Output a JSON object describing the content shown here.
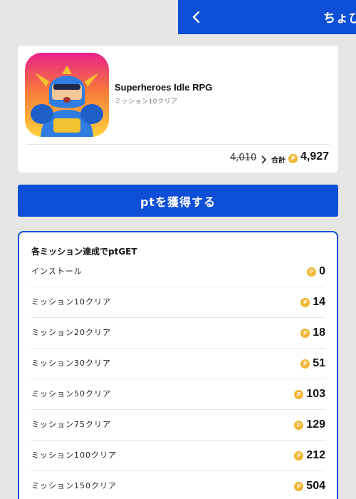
{
  "header": {
    "title": "ちょびリッチ",
    "back_icon": "chevron-left-icon",
    "color": "#0d4fd6"
  },
  "app": {
    "name": "Superheroes Idle RPG",
    "subtitle": "ミッション10クリア",
    "old_points": "4,010",
    "total_label": "合計",
    "total_points": "4,927",
    "coin_symbol": "P"
  },
  "get_button": {
    "label": "ptを獲得する"
  },
  "missions": {
    "title": "各ミッション達成でptGET",
    "coin_color": "#f2b632",
    "items": [
      {
        "label": "インストール",
        "points": "0"
      },
      {
        "label": "ミッション10クリア",
        "points": "14"
      },
      {
        "label": "ミッション20クリア",
        "points": "18"
      },
      {
        "label": "ミッション30クリア",
        "points": "51"
      },
      {
        "label": "ミッション50クリア",
        "points": "103"
      },
      {
        "label": "ミッション75クリア",
        "points": "129"
      },
      {
        "label": "ミッション100クリア",
        "points": "212"
      },
      {
        "label": "ミッション150クリア",
        "points": "504"
      }
    ]
  }
}
